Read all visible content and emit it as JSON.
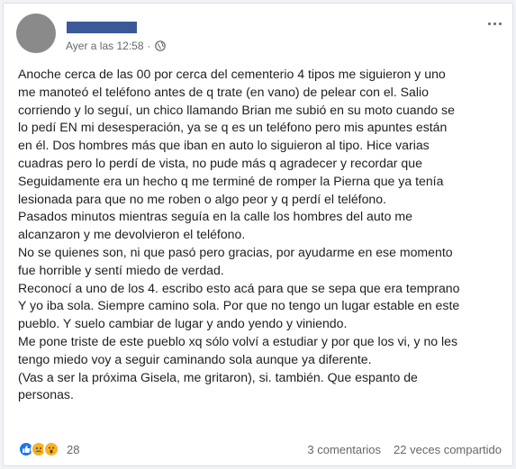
{
  "post": {
    "timestamp": "Ayer a las 12:58",
    "separator": "·",
    "privacy_icon": "globe-icon",
    "lines": [
      "Anoche cerca de las 00 por cerca del cementerio 4 tipos me siguieron y uno",
      "me manoteó el teléfono antes de q trate (en vano) de pelear con el. Salio",
      "corriendo y lo seguí, un chico llamando Brian me subió en su moto cuando se",
      "lo pedí EN mi desesperación, ya se q es un teléfono pero mis apuntes están",
      "en él. Dos hombres más que iban en auto lo siguieron al tipo. Hice varias",
      "cuadras pero lo perdí de vista, no pude más q agradecer y recordar que",
      "Seguidamente era un hecho q me terminé de romper la Pierna que ya tenía",
      "lesionada para que no me roben o algo peor y q perdí el teléfono.",
      "Pasados minutos mientras seguía en la calle los hombres del auto me",
      "alcanzaron y me devolvieron el teléfono.",
      "No se quienes son, ni que pasó pero gracias, por ayudarme en ese momento",
      "fue horrible y sentí miedo de verdad.",
      "Reconocí a uno de los 4. escribo esto acá para que se sepa que era temprano",
      "Y yo iba sola. Siempre camino sola. Por que no tengo un lugar estable en este",
      "pueblo. Y suelo cambiar de lugar y ando yendo y viniendo.",
      "Me pone triste de este pueblo xq sólo volví a estudiar y por que los vi, y no les",
      "tengo miedo voy a seguir caminando sola aunque ya diferente.",
      "(Vas a ser la próxima Gisela, me gritaron), si. también. Que espanto de",
      "personas."
    ]
  },
  "footer": {
    "reaction_icons": [
      "like-icon",
      "sad-icon",
      "wow-icon"
    ],
    "reaction_count": "28",
    "comments": "3 comentarios",
    "shares": "22 veces compartido"
  },
  "colors": {
    "name_redaction": "#3b5998",
    "avatar": "#8a8a8a",
    "like_blue": "#1877f2",
    "emoji_yellow": "#f7b125"
  }
}
